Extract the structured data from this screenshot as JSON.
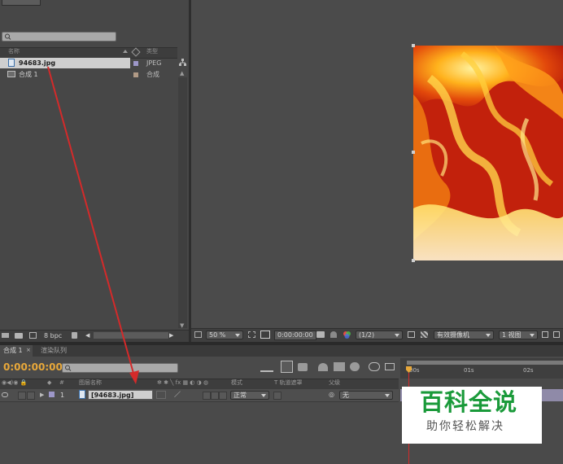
{
  "project": {
    "columns": {
      "name": "名称",
      "type": "类型"
    },
    "items": [
      {
        "name": "94683.jpg",
        "type": "JPEG",
        "selected": true,
        "icon": "image-file-icon"
      },
      {
        "name": "合成 1",
        "type": "合成",
        "selected": false,
        "icon": "composition-icon"
      }
    ],
    "bpc": "8 bpc"
  },
  "viewer": {
    "zoom": "50 %",
    "timecode": "0:00:00:00",
    "resolution": "(1/2)",
    "camera": "有效摄像机",
    "views": "1 视图"
  },
  "timeline": {
    "tabs": [
      "合成 1",
      "渲染队列"
    ],
    "current_time": "0:00:00:00",
    "column_headers": {
      "number": "#",
      "source_name": "图层名称",
      "mode": "模式",
      "trkmat": "T  轨道遮罩",
      "parent": "父级"
    },
    "ruler": [
      "00s",
      "01s",
      "02s"
    ],
    "layers": [
      {
        "index": "1",
        "name": "[94683.jpg]",
        "mode": "正常",
        "parent": "无"
      }
    ]
  },
  "watermark": {
    "title": "百科全说",
    "subtitle": "助你轻松解决"
  },
  "colors": {
    "annotation_arrow": "#d42a2a",
    "timecode": "#e8a83a",
    "label_swatch": "#9d97c9",
    "watermark_green": "#1a9a3a"
  }
}
